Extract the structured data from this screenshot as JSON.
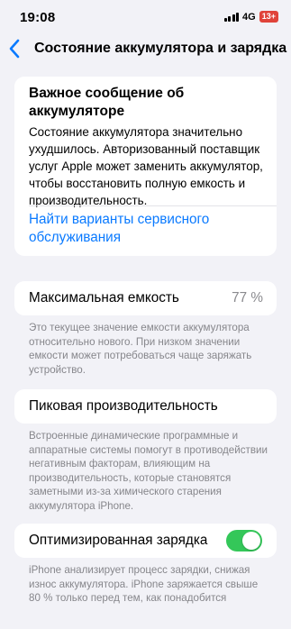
{
  "status_bar": {
    "time": "19:08",
    "network": "4G",
    "battery": "13+"
  },
  "nav": {
    "back_icon": "chevron-left-icon",
    "title": "Состояние аккумулятора и зарядка"
  },
  "warning": {
    "title": "Важное сообщение об аккумуляторе",
    "text": "Состояние аккумулятора значительно ухудшилось. Авторизованный поставщик услуг Apple может заменить аккумулятор, чтобы восстановить полную емкость и производительность.",
    "link": "Найти варианты сервисного обслуживания"
  },
  "max_capacity": {
    "label": "Максимальная емкость",
    "value": "77 %",
    "footnote": "Это текущее значение емкости аккумулятора относительно нового. При низком значении емкости может потребоваться чаще заряжать устройство."
  },
  "peak_performance": {
    "label": "Пиковая производительность",
    "footnote": "Встроенные динамические программные и аппаратные системы помогут в противодействии негативным факторам, влияющим на производительность, которые становятся заметными из-за химического старения аккумулятора iPhone."
  },
  "optimized_charging": {
    "label": "Оптимизированная зарядка",
    "enabled": true,
    "footnote": "iPhone анализирует процесс зарядки, снижая износ аккумулятора. iPhone заряжается свыше 80 % только перед тем, как понадобится"
  },
  "colors": {
    "background": "#f2f2f7",
    "accent": "#0a7aff",
    "toggle_on": "#34c759",
    "battery_badge": "#e0433a"
  }
}
